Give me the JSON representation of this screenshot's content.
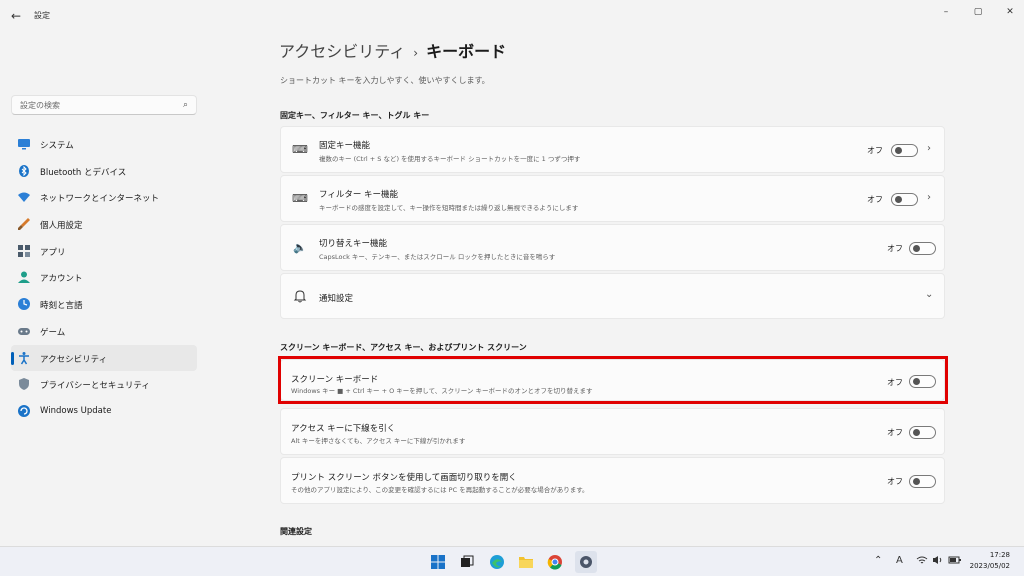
{
  "window": {
    "title": "設定",
    "minimize": "–",
    "maximize": "▢",
    "close": "✕"
  },
  "search": {
    "placeholder": "設定の検索"
  },
  "sidebar": {
    "items": [
      {
        "label": "システム"
      },
      {
        "label": "Bluetooth とデバイス"
      },
      {
        "label": "ネットワークとインターネット"
      },
      {
        "label": "個人用設定"
      },
      {
        "label": "アプリ"
      },
      {
        "label": "アカウント"
      },
      {
        "label": "時刻と言語"
      },
      {
        "label": "ゲーム"
      },
      {
        "label": "アクセシビリティ"
      },
      {
        "label": "プライバシーとセキュリティ"
      },
      {
        "label": "Windows Update"
      }
    ],
    "active_index": 8
  },
  "main": {
    "breadcrumb_parent": "アクセシビリティ",
    "breadcrumb_sep": "›",
    "breadcrumb_current": "キーボード",
    "subtitle": "ショートカット キーを入力しやすく、使いやすくします。",
    "section1": "固定キー、フィルター キー、トグル キー",
    "section2": "スクリーン キーボード、アクセス キー、およびプリント スクリーン",
    "section3": "関連設定",
    "sticky": {
      "title": "固定キー機能",
      "desc": "複数のキー (Ctrl + S など) を使用するキーボード ショートカットを一度に 1 つずつ押す",
      "state": "オフ"
    },
    "filter": {
      "title": "フィルター キー機能",
      "desc": "キーボードの感度を設定して、キー操作を短時間または繰り返し無視できるようにします",
      "state": "オフ"
    },
    "toggle": {
      "title": "切り替えキー機能",
      "desc": "CapsLock キー、テンキー、またはスクロール ロックを押したときに音を鳴らす",
      "state": "オフ"
    },
    "notify": {
      "title": "通知設定"
    },
    "osk": {
      "title": "スクリーン キーボード",
      "desc": "Windows キー ■ + Ctrl キー + O キーを押して、スクリーン キーボードのオンとオフを切り替えます",
      "state": "オフ"
    },
    "access": {
      "title": "アクセス キーに下線を引く",
      "desc": "Alt キーを押さなくても、アクセス キーに下線が引かれます",
      "state": "オフ"
    },
    "prtsc": {
      "title": "プリント スクリーン ボタンを使用して画面切り取りを開く",
      "desc": "その他のアプリ設定により、この変更を確認するには PC を再起動することが必要な場合があります。",
      "state": "オフ"
    }
  },
  "taskbar": {
    "time": "17:28",
    "date": "2023/05/02",
    "ime": "A"
  },
  "colors": {
    "accent": "#005fb8",
    "highlight": "#e00000"
  }
}
